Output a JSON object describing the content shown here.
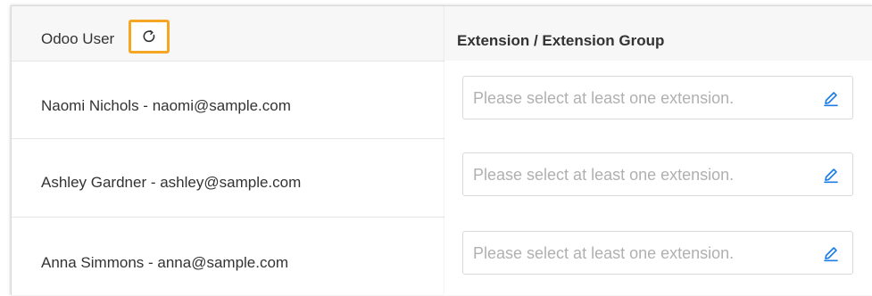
{
  "table": {
    "user_header": "Odoo User",
    "extension_header": "Extension / Extension Group",
    "rows": [
      {
        "user": "Naomi Nichols - naomi@sample.com",
        "extension_placeholder": "Please select at least one extension."
      },
      {
        "user": "Ashley Gardner - ashley@sample.com",
        "extension_placeholder": "Please select at least one extension."
      },
      {
        "user": "Anna Simmons - anna@sample.com",
        "extension_placeholder": "Please select at least one extension."
      }
    ]
  },
  "icons": {
    "refresh": "refresh-icon",
    "edit": "pencil-icon"
  },
  "colors": {
    "highlight": "#f5a623",
    "edit_icon": "#1e7de4",
    "placeholder": "#b0b0b0"
  }
}
